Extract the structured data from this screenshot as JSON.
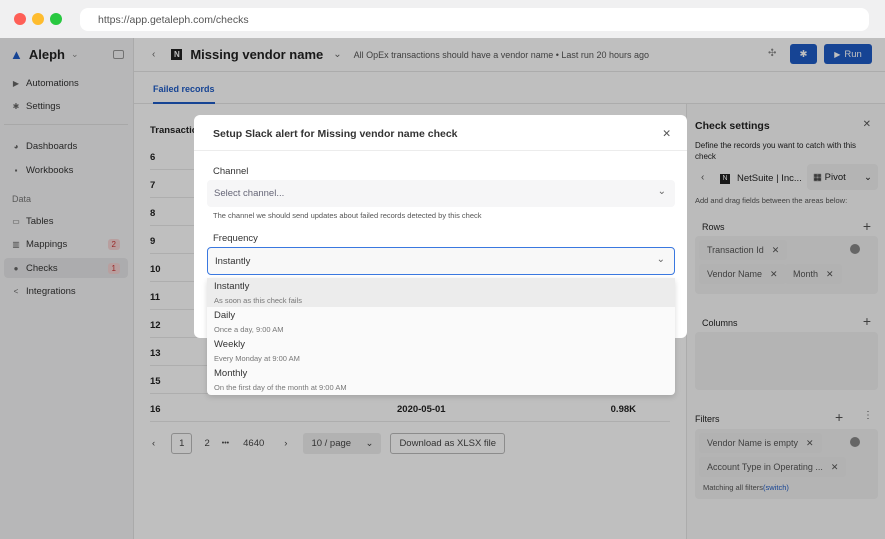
{
  "browser": {
    "url": "https://app.getaleph.com/checks"
  },
  "sidebar": {
    "brand": "Aleph",
    "items": [
      {
        "label": "Automations",
        "icon": "play-icon"
      },
      {
        "label": "Settings",
        "icon": "gear-icon"
      },
      {
        "label": "Dashboards",
        "icon": "pie-icon"
      },
      {
        "label": "Workbooks",
        "icon": "grid-icon"
      },
      {
        "label": "Tables",
        "icon": "table-icon"
      },
      {
        "label": "Mappings",
        "icon": "bars-icon",
        "badge": "2"
      },
      {
        "label": "Checks",
        "icon": "check-circle-icon",
        "badge": "1"
      },
      {
        "label": "Integrations",
        "icon": "share-icon"
      }
    ],
    "section_data": "Data"
  },
  "header": {
    "title": "Missing vendor name",
    "subtitle": "All OpEx transactions should have a vendor name • Last run 20 hours ago",
    "run_label": "Run"
  },
  "tabs": [
    {
      "label": "Failed records"
    }
  ],
  "table": {
    "header": "Transactio",
    "rows": [
      {
        "id": "6"
      },
      {
        "id": "7"
      },
      {
        "id": "8"
      },
      {
        "id": "9"
      },
      {
        "id": "10"
      },
      {
        "id": "11"
      },
      {
        "id": "12"
      },
      {
        "id": "13"
      },
      {
        "id": "15"
      },
      {
        "id": "16",
        "date": "2020-05-01",
        "amount": "0.98K"
      }
    ]
  },
  "pagination": {
    "pages": [
      "1",
      "2",
      "•••",
      "4640"
    ],
    "page_size": "10 / page",
    "download": "Download as XLSX file"
  },
  "panel": {
    "title": "Check settings",
    "description": "Define the records you want to catch with this check",
    "source": "NetSuite | Inc...",
    "view": "Pivot",
    "hint": "Add and drag fields between the areas below:",
    "rows_label": "Rows",
    "row_chips": [
      "Transaction Id",
      "Vendor Name",
      "Month"
    ],
    "columns_label": "Columns",
    "filters_label": "Filters",
    "filter_chips": [
      "Vendor Name is empty",
      "Account Type in Operating ..."
    ],
    "matching": "Matching all filters",
    "switch": "(switch)"
  },
  "modal": {
    "title": "Setup Slack alert for Missing vendor name check",
    "channel_label": "Channel",
    "channel_placeholder": "Select channel...",
    "channel_help": "The channel we should send updates about failed records detected by this check",
    "frequency_label": "Frequency",
    "frequency_value": "Instantly",
    "options": [
      {
        "label": "Instantly",
        "desc": "As soon as this check fails"
      },
      {
        "label": "Daily",
        "desc": "Once a day, 9:00 AM"
      },
      {
        "label": "Weekly",
        "desc": "Every Monday at 9:00 AM"
      },
      {
        "label": "Monthly",
        "desc": "On the first day of the month at 9:00 AM"
      }
    ]
  },
  "colors": {
    "accent": "#1e5bc6",
    "badge": "#c33333"
  }
}
